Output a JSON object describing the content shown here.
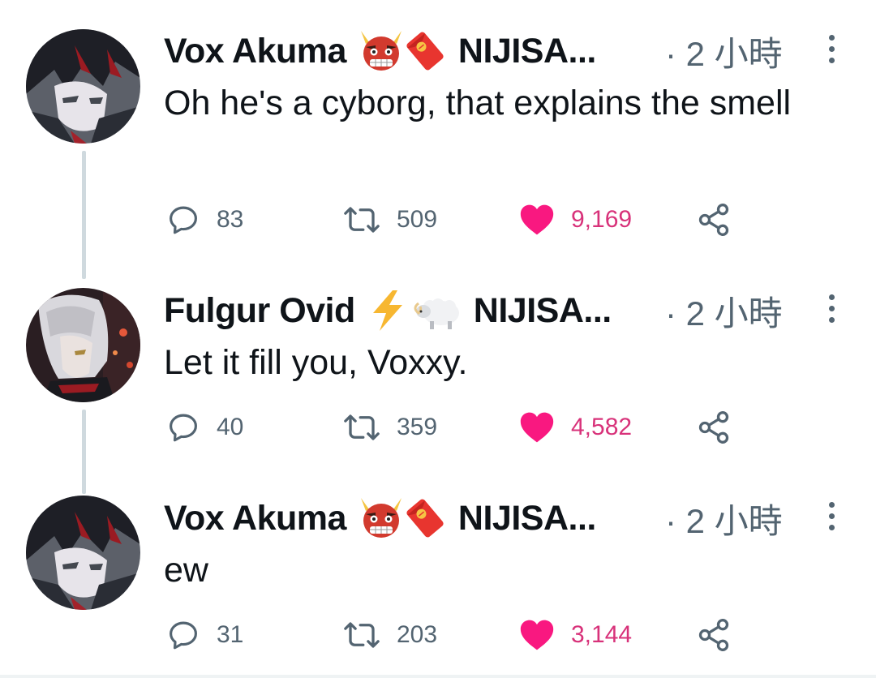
{
  "tweets": [
    {
      "author": "Vox Akuma",
      "emoji_icons": [
        "oni-mask-icon",
        "red-envelope-icon"
      ],
      "handle": "NIJISA...",
      "time": "· 2 小時",
      "text": "Oh he's a cyborg, that explains the smell",
      "replies": "83",
      "retweets": "509",
      "likes": "9,169"
    },
    {
      "author": "Fulgur Ovid",
      "emoji_icons": [
        "lightning-icon",
        "ram-icon"
      ],
      "handle": "NIJISA...",
      "time": "· 2 小時",
      "text": "Let it fill you, Voxxy.",
      "replies": "40",
      "retweets": "359",
      "likes": "4,582"
    },
    {
      "author": "Vox Akuma",
      "emoji_icons": [
        "oni-mask-icon",
        "red-envelope-icon"
      ],
      "handle": "NIJISA...",
      "time": "· 2 小時",
      "text": "ew",
      "replies": "31",
      "retweets": "203",
      "likes": "3,144"
    }
  ],
  "colors": {
    "text": "#0f1419",
    "secondary": "#536471",
    "like": "#f91880",
    "like_count": "#d8327a",
    "thread_line": "#cfd9de"
  }
}
